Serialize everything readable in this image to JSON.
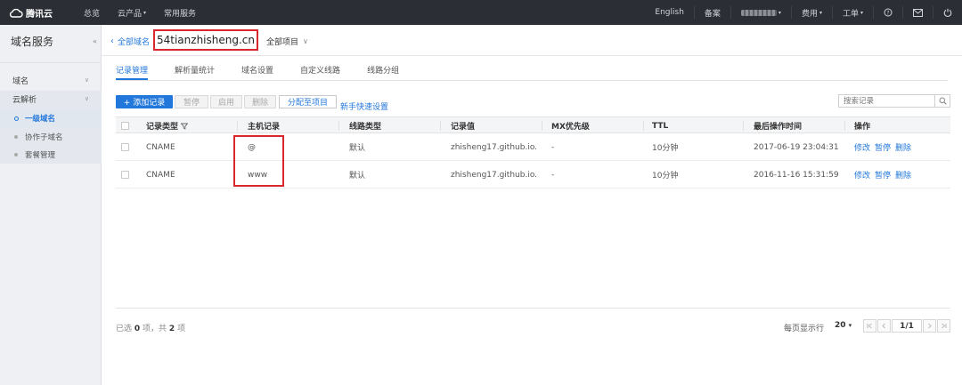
{
  "topbar": {
    "brand": "腾讯云",
    "nav": [
      "总览",
      "云产品",
      "常用服务"
    ],
    "right": {
      "language": "English",
      "filing": "备案",
      "billing": "费用",
      "ticket": "工单"
    }
  },
  "sidebar": {
    "title": "域名服务",
    "collapse_glyph": "«",
    "items": [
      {
        "label": "域名"
      },
      {
        "label": "云解析"
      }
    ],
    "subitems": [
      {
        "label": "一级域名",
        "active": true
      },
      {
        "label": "协作子域名"
      },
      {
        "label": "套餐管理"
      }
    ]
  },
  "header": {
    "back_label": "全部域名",
    "domain": "54tianzhisheng.cn",
    "project": "全部项目"
  },
  "tabs": [
    "记录管理",
    "解析量统计",
    "域名设置",
    "自定义线路",
    "线路分组"
  ],
  "toolbar": {
    "add": "+ 添加记录",
    "pause": "暂停",
    "enable": "启用",
    "delete": "删除",
    "assign": "分配至项目",
    "quick_setup": "新手快速设置",
    "search_placeholder": "搜索记录"
  },
  "table": {
    "columns": [
      "记录类型",
      "主机记录",
      "线路类型",
      "记录值",
      "MX优先级",
      "TTL",
      "最后操作时间",
      "操作"
    ],
    "rows": [
      {
        "type": "CNAME",
        "host": "@",
        "line": "默认",
        "value": "zhisheng17.github.io.",
        "mx": "-",
        "ttl": "10分钟",
        "time": "2017-06-19 23:04:31"
      },
      {
        "type": "CNAME",
        "host": "www",
        "line": "默认",
        "value": "zhisheng17.github.io.",
        "mx": "-",
        "ttl": "10分钟",
        "time": "2016-11-16 15:31:59"
      }
    ],
    "actions": [
      "修改",
      "暂停",
      "删除"
    ]
  },
  "footer": {
    "status_prefix": "已选",
    "selected": "0",
    "status_mid": "项，共",
    "total": "2",
    "status_suffix": "项",
    "per_page_label": "每页显示行",
    "page_size": "20",
    "page": "1/1"
  },
  "colors": {
    "accent": "#2277da",
    "highlight": "#d9272e",
    "topbar": "#2b2f35"
  }
}
